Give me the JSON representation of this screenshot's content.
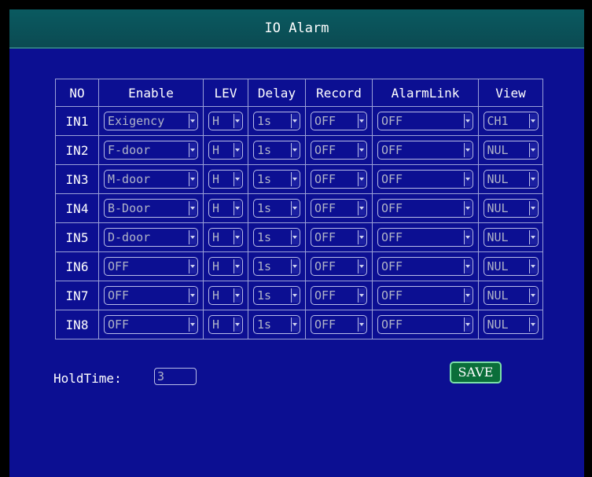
{
  "title": "IO Alarm",
  "columns": [
    "NO",
    "Enable",
    "LEV",
    "Delay",
    "Record",
    "AlarmLink",
    "View"
  ],
  "rows": [
    {
      "no": "IN1",
      "enable": "Exigency",
      "lev": "H",
      "delay": "1s",
      "record": "OFF",
      "alarmlink": "OFF",
      "view": "CH1"
    },
    {
      "no": "IN2",
      "enable": "F-door",
      "lev": "H",
      "delay": "1s",
      "record": "OFF",
      "alarmlink": "OFF",
      "view": "NUL"
    },
    {
      "no": "IN3",
      "enable": "M-door",
      "lev": "H",
      "delay": "1s",
      "record": "OFF",
      "alarmlink": "OFF",
      "view": "NUL"
    },
    {
      "no": "IN4",
      "enable": "B-Door",
      "lev": "H",
      "delay": "1s",
      "record": "OFF",
      "alarmlink": "OFF",
      "view": "NUL"
    },
    {
      "no": "IN5",
      "enable": "D-door",
      "lev": "H",
      "delay": "1s",
      "record": "OFF",
      "alarmlink": "OFF",
      "view": "NUL"
    },
    {
      "no": "IN6",
      "enable": "OFF",
      "lev": "H",
      "delay": "1s",
      "record": "OFF",
      "alarmlink": "OFF",
      "view": "NUL"
    },
    {
      "no": "IN7",
      "enable": "OFF",
      "lev": "H",
      "delay": "1s",
      "record": "OFF",
      "alarmlink": "OFF",
      "view": "NUL"
    },
    {
      "no": "IN8",
      "enable": "OFF",
      "lev": "H",
      "delay": "1s",
      "record": "OFF",
      "alarmlink": "OFF",
      "view": "NUL"
    }
  ],
  "hold_time": {
    "label": "HoldTime:",
    "value": "3"
  },
  "save_label": "SAVE",
  "colors": {
    "background": "#0c0f92",
    "titlebar": "#0b4a52",
    "save_button": "#0a6e3a"
  },
  "icons": {
    "dropdown": "dropdown-arrow-icon"
  }
}
